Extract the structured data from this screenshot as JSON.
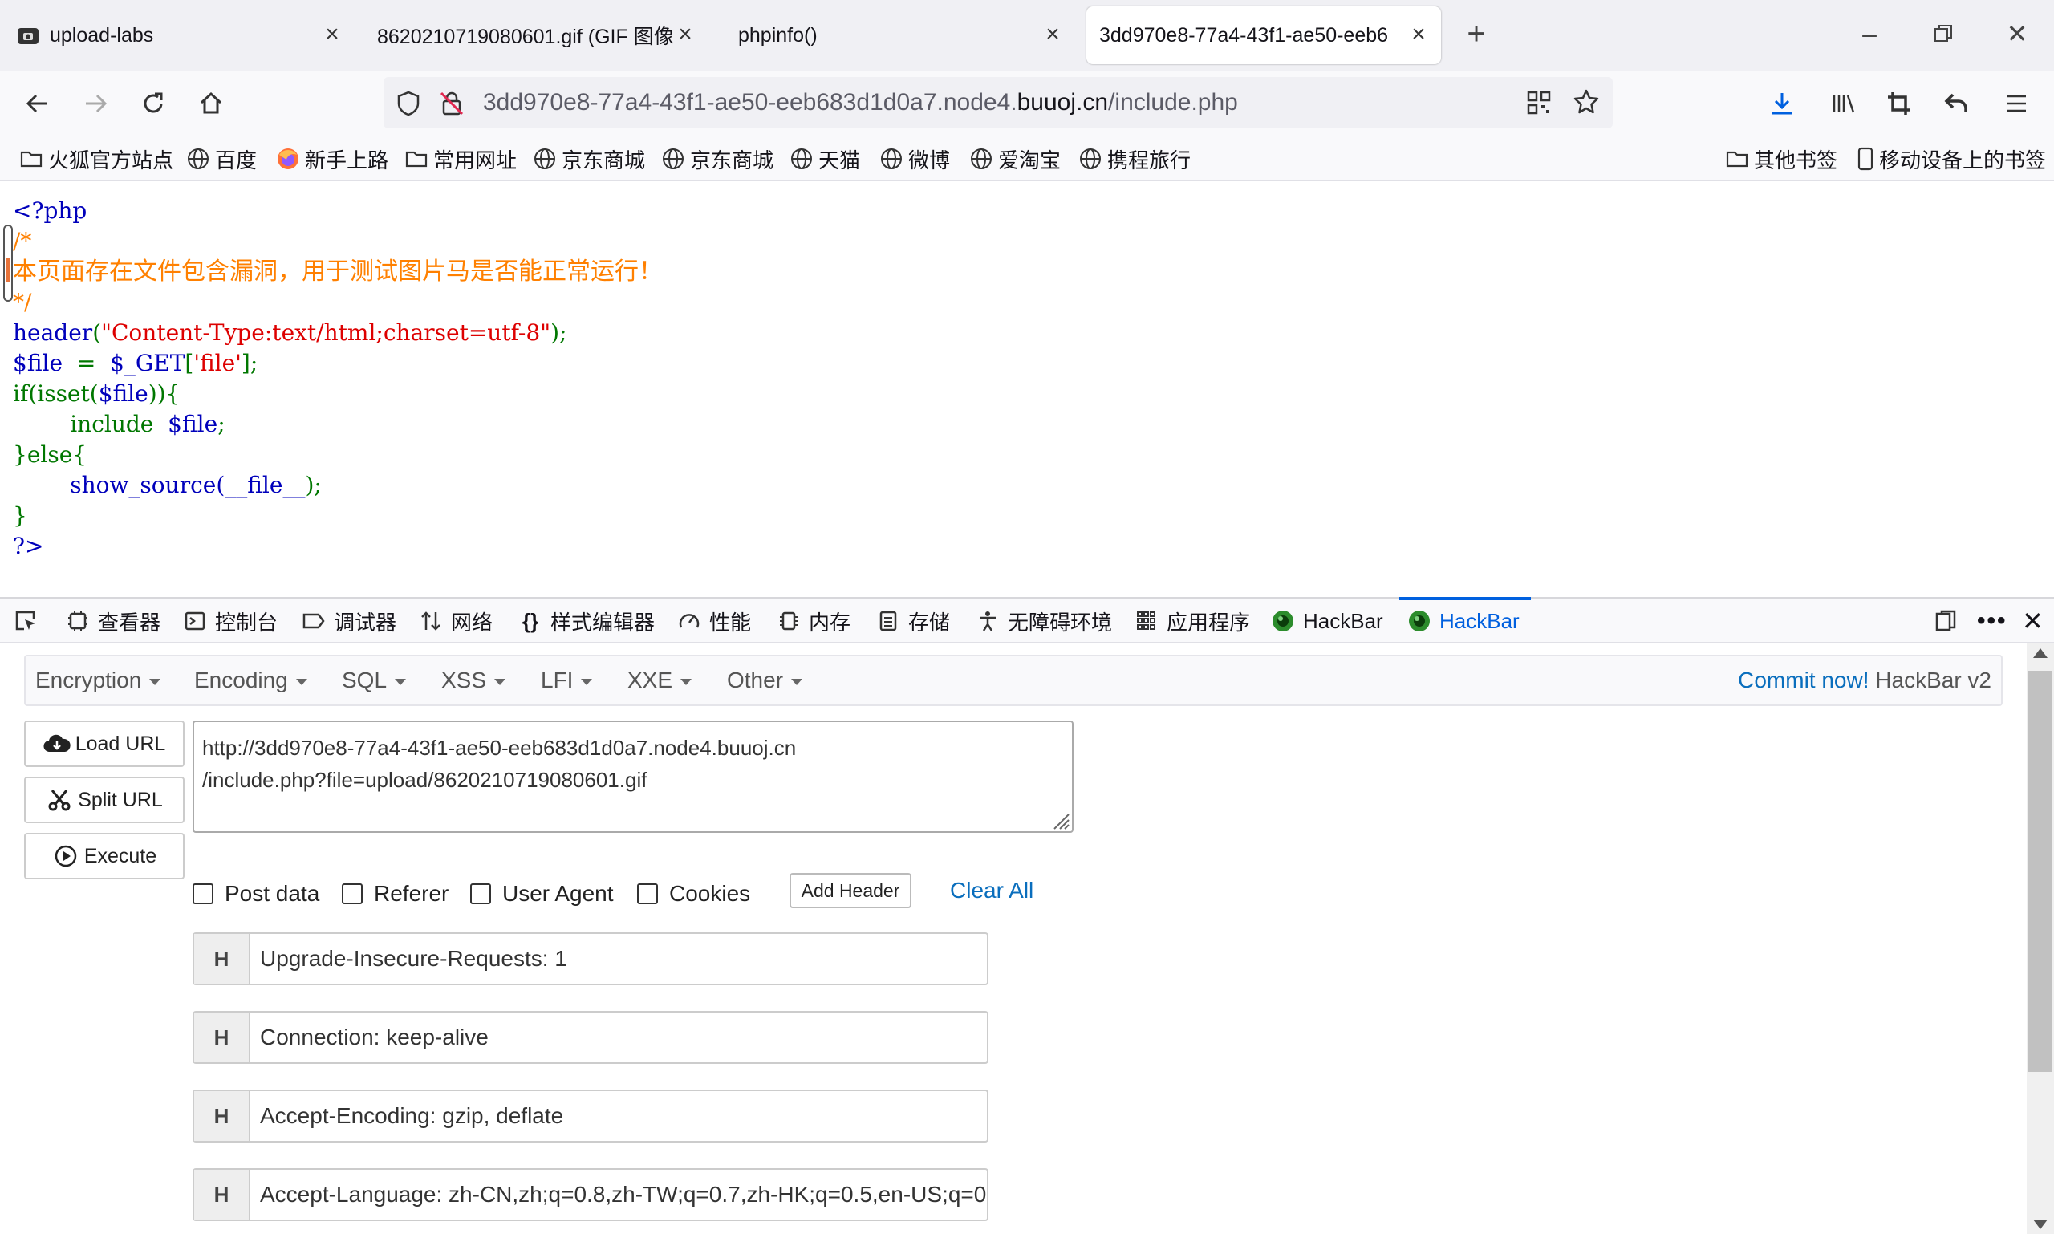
{
  "tabs": [
    {
      "title": "upload-labs",
      "selected": false
    },
    {
      "title": "8620210719080601.gif (GIF 图像)",
      "selected": false
    },
    {
      "title": "phpinfo()",
      "selected": false
    },
    {
      "title": "3dd970e8-77a4-43f1-ae50-eeb6",
      "selected": true
    }
  ],
  "url": {
    "prefix": "3dd970e8-77a4-43f1-ae50-eeb683d1d0a7.node4.",
    "domain": "buuoj.cn",
    "path": "/include.php"
  },
  "bookmarks": [
    "火狐官方站点",
    "百度",
    "新手上路",
    "常用网址",
    "京东商城",
    "京东商城",
    "天猫",
    "微博",
    "爱淘宝",
    "携程旅行"
  ],
  "bookmarks_right": [
    "其他书签",
    "移动设备上的书签"
  ],
  "source": {
    "open_tag": "<?php",
    "comment_open": "/*",
    "comment_text": "本页面存在文件包含漏洞，用于测试图片马是否能正常运行！",
    "comment_close": "*/",
    "header_fn": "header",
    "header_arg": "\"Content-Type:text/html;charset=utf-8\"",
    "file_var": "$file",
    "get_expr": "$_GET",
    "get_key": "'file'",
    "if_kw": "if(isset(",
    "include_kw": "include",
    "else_kw": "}else{",
    "show_source": "show_source(",
    "file_const": "__file__",
    "close_brace": "}",
    "close_tag": "?>"
  },
  "devtools": [
    "查看器",
    "控制台",
    "调试器",
    "网络",
    "样式编辑器",
    "性能",
    "内存",
    "存储",
    "无障碍环境",
    "应用程序",
    "HackBar",
    "HackBar"
  ],
  "hackbar": {
    "menu": [
      "Encryption",
      "Encoding",
      "SQL",
      "XSS",
      "LFI",
      "XXE",
      "Other"
    ],
    "commit_link": "Commit now!",
    "commit_version": "HackBar v2",
    "buttons": [
      "Load URL",
      "Split URL",
      "Execute"
    ],
    "url_line1": "http://3dd970e8-77a4-43f1-ae50-eeb683d1d0a7.node4.buuoj.cn",
    "url_line2": "/include.php?file=upload/8620210719080601.gif",
    "checkboxes": [
      "Post data",
      "Referer",
      "User Agent",
      "Cookies"
    ],
    "add_header": "Add Header",
    "clear_all": "Clear All",
    "header_key": "H",
    "headers": [
      "Upgrade-Insecure-Requests: 1",
      "Connection: keep-alive",
      "Accept-Encoding: gzip, deflate",
      "Accept-Language: zh-CN,zh;q=0.8,zh-TW;q=0.7,zh-HK;q=0.5,en-US;q=0"
    ]
  },
  "colors": {
    "accent": "#0060df",
    "php_blue": "#0000bb",
    "php_green": "#007700",
    "php_red": "#dd0000",
    "php_orange": "#ff8000",
    "link": "#0a6ebd"
  }
}
